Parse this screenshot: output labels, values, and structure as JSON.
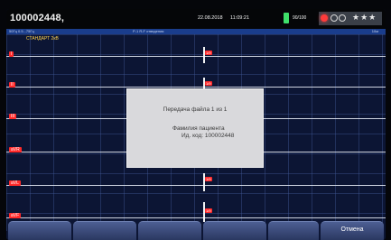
{
  "status_bar": {
    "patient_id": "100002448,",
    "date": "22.08.2018",
    "time": "11:09:21",
    "battery_text": "90/100",
    "stars": "★★★"
  },
  "info_bar": {
    "left_text": "50Гц 0.5...75Гц",
    "mid_text": "Р-1 R-F отведения",
    "right_text": "10м"
  },
  "waveform": {
    "mode": "СТАНДАРТ 2кВ",
    "leads": [
      "I",
      "II",
      "III",
      "aVR",
      "aVL",
      "aVF"
    ],
    "scale_mark": "1/9"
  },
  "dialog": {
    "title": "Передача файла 1 из 1",
    "name_label": "Фамилия пациента",
    "code_line": "Ид. код: 100002448"
  },
  "buttons": {
    "cancel": "Отмена"
  },
  "colors": {
    "background": "#0c1534",
    "info_bar": "#1a3d8c",
    "lead_label": "#ff2a2a",
    "battery": "#3fe06a",
    "button": "#3a4a7a",
    "dialog": "#d9d9dc"
  }
}
